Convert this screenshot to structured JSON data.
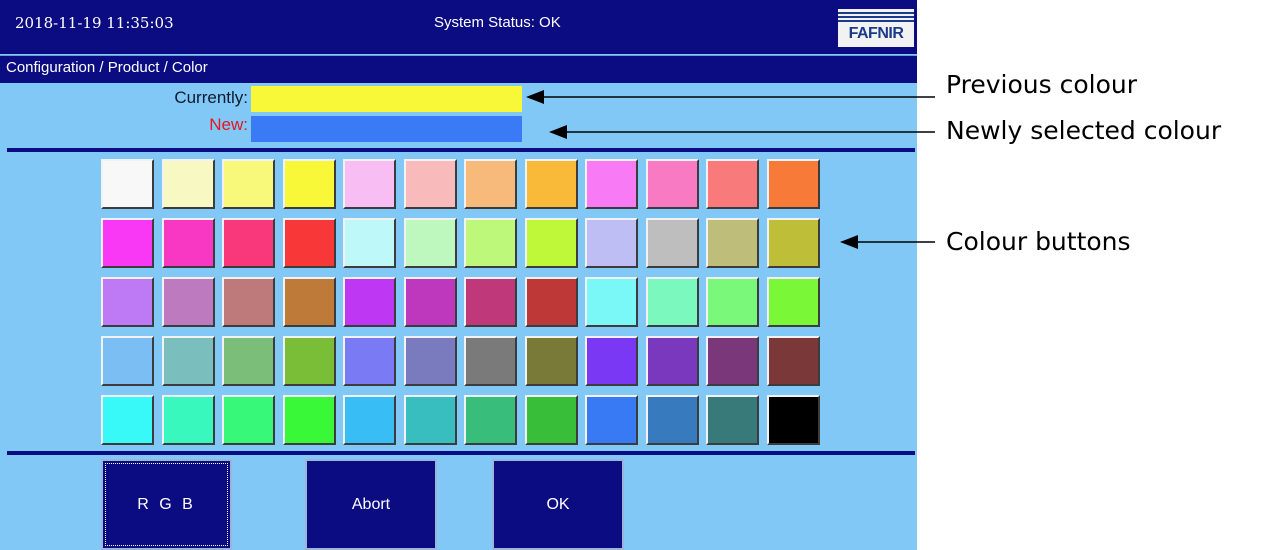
{
  "header": {
    "datetime": "2018-11-19  11:35:03",
    "status": "System Status: OK",
    "logo_text": "FAFNIR"
  },
  "breadcrumb": "Configuration / Product / Color",
  "current": {
    "label": "Currently:",
    "color": "#f8f838"
  },
  "new": {
    "label": "New:",
    "color": "#3a7af4"
  },
  "palette": [
    [
      "#f8f8f8",
      "#f8f8c2",
      "#f8f87a",
      "#f8f838",
      "#f8bef4",
      "#f8baba",
      "#f8ba7a",
      "#f8ba38",
      "#f87af4",
      "#f87ac2",
      "#f87a7a",
      "#f87a38"
    ],
    [
      "#f838f4",
      "#f838c2",
      "#f8387a",
      "#f83838",
      "#bef8f8",
      "#bef8be",
      "#bef87a",
      "#bef838",
      "#bebef4",
      "#bebebe",
      "#bebe7a",
      "#bebe38"
    ],
    [
      "#be7af4",
      "#be7abe",
      "#be7a7a",
      "#be7a38",
      "#be38f4",
      "#be38be",
      "#be387a",
      "#be3838",
      "#7af8f8",
      "#7af8be",
      "#7af87a",
      "#7af838"
    ],
    [
      "#7abef4",
      "#7abebe",
      "#7abe7a",
      "#7abe38",
      "#7a7af4",
      "#7a7abe",
      "#7a7a7a",
      "#7a7a38",
      "#7a38f4",
      "#7a38be",
      "#7a387a",
      "#7a3838"
    ],
    [
      "#38f8f8",
      "#38f8be",
      "#38f87a",
      "#38f838",
      "#38bef4",
      "#38bebe",
      "#38be7a",
      "#38be38",
      "#387af4",
      "#387abe",
      "#387a7a",
      "#000000"
    ]
  ],
  "buttons": {
    "rgb": "R G B",
    "abort": "Abort",
    "ok": "OK"
  },
  "annotations": {
    "previous": "Previous colour",
    "newly_selected": "Newly selected colour",
    "colour_buttons": "Colour buttons"
  }
}
